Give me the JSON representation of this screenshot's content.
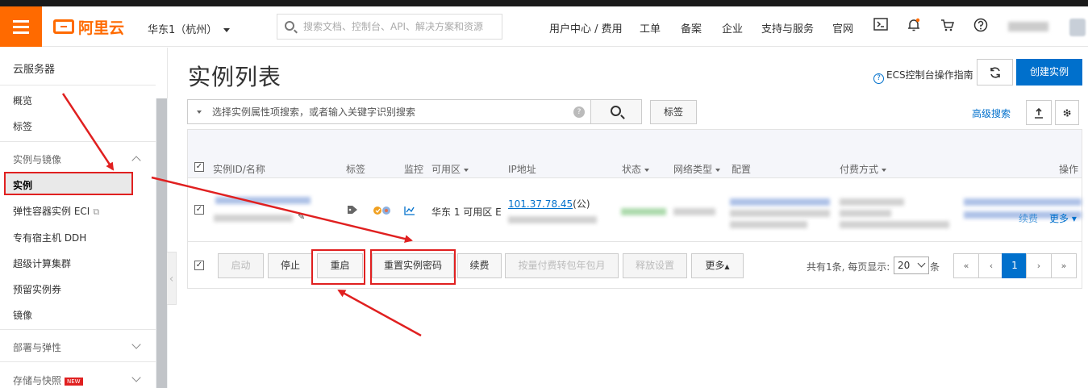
{
  "header": {
    "logo_text": "阿里云",
    "region": "华东1（杭州）",
    "search_placeholder": "搜索文档、控制台、API、解决方案和资源",
    "nav": [
      "用户中心 / 费用",
      "工单",
      "备案",
      "企业",
      "支持与服务",
      "官网"
    ],
    "icons": [
      "terminal-icon",
      "bell-icon",
      "cart-icon",
      "help-icon"
    ]
  },
  "sidebar": {
    "title": "云服务器",
    "items_top": [
      "概览",
      "标签"
    ],
    "group_instances": "实例与镜像",
    "active_item": "实例",
    "items": [
      "弹性容器实例 ECI",
      "专有宿主机 DDH",
      "超级计算集群",
      "预留实例券",
      "镜像"
    ],
    "group_deploy": "部署与弹性",
    "group_storage": "存储与快照",
    "new_badge": "NEW"
  },
  "main": {
    "title": "实例列表",
    "guide": "ECS控制台操作指南",
    "create_button": "创建实例",
    "filter_placeholder": "选择实例属性项搜索，或者输入关键字识别搜索",
    "tag_button": "标签",
    "advanced_search": "高级搜索"
  },
  "table": {
    "headers": [
      "实例ID/名称",
      "标签",
      "监控",
      "可用区",
      "IP地址",
      "状态",
      "网络类型",
      "配置",
      "付费方式",
      "操作"
    ],
    "row": {
      "zone": "华东 1 可用区 E",
      "ip": "101.37.78.45",
      "ip_suffix": "(公)",
      "action_renew": "续费",
      "action_more": "更多"
    }
  },
  "footer": {
    "buttons": [
      "启动",
      "停止",
      "重启",
      "重置实例密码",
      "续费",
      "按量付费转包年包月",
      "释放设置",
      "更多"
    ],
    "total": "共有1条, 每页显示:",
    "page_size": "20",
    "suffix": "条",
    "pager": [
      "«",
      "‹",
      "1",
      "›",
      "»"
    ]
  },
  "colors": {
    "brand": "#ff6a00",
    "primary": "#0070cc",
    "annotation": "#e02020"
  }
}
